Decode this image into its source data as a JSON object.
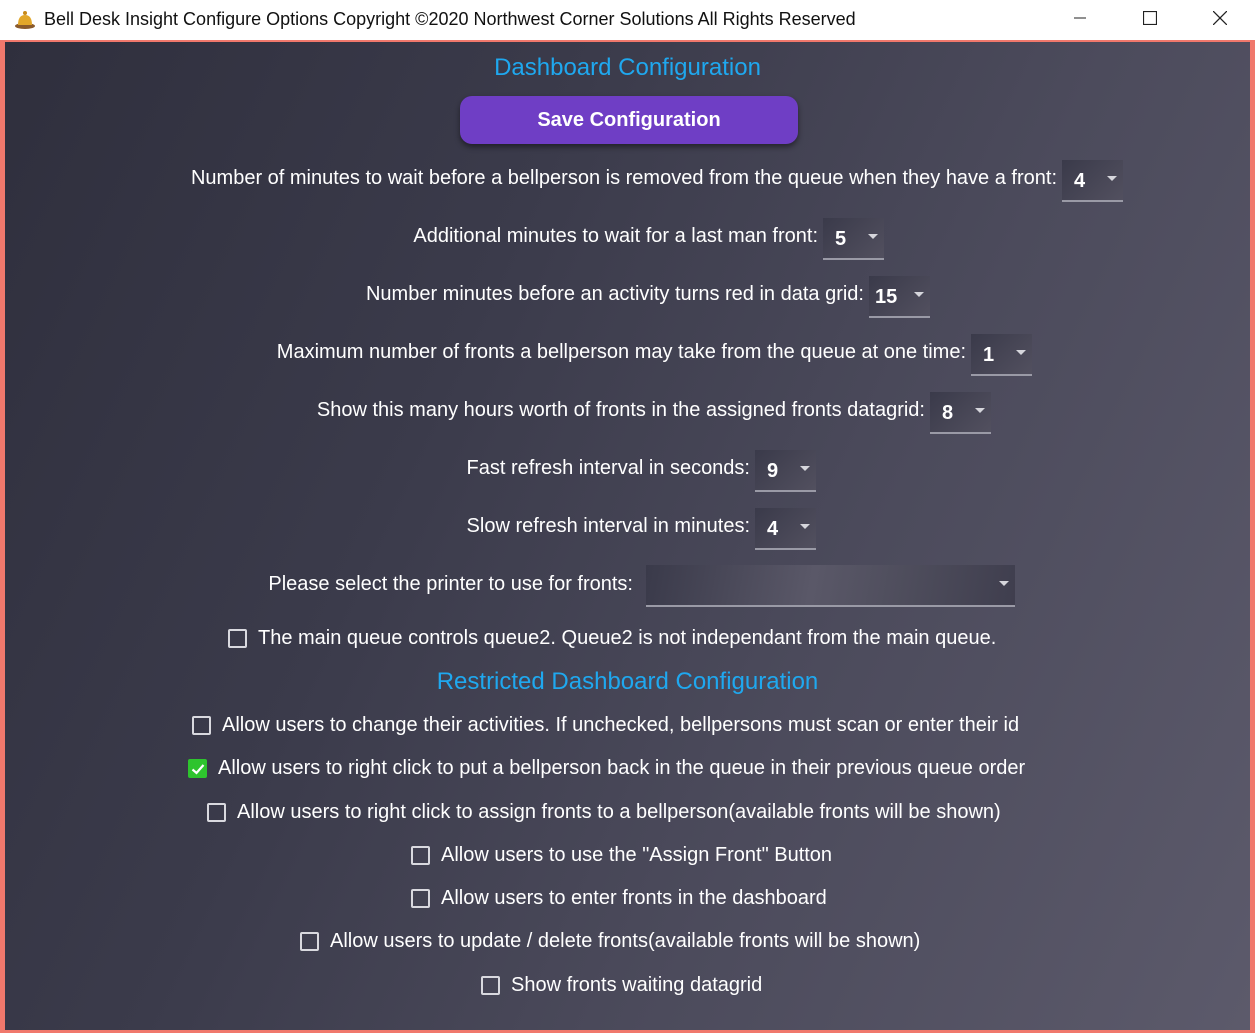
{
  "window": {
    "title": "Bell Desk Insight Configure Options Copyright ©2020 Northwest Corner Solutions All Rights Reserved",
    "app_icon": "bell-icon"
  },
  "dashboard": {
    "heading": "Dashboard Configuration",
    "save_label": "Save Configuration",
    "settings": [
      {
        "label": "Number of minutes to wait before a bellperson is removed from the queue when they have a front:",
        "value": "4"
      },
      {
        "label": "Additional minutes to wait for a last man front:",
        "value": "5"
      },
      {
        "label": "Number minutes before an activity turns red in data grid:",
        "value": "15"
      },
      {
        "label": "Maximum number of fronts a bellperson may take from the queue at one time:",
        "value": "1"
      },
      {
        "label": "Show this many hours worth of fronts in the assigned fronts datagrid:",
        "value": "8"
      },
      {
        "label": "Fast refresh interval in seconds:",
        "value": "9"
      },
      {
        "label": "Slow refresh interval in minutes:",
        "value": "4"
      }
    ],
    "printer_label": "Please select the printer to use for fronts:",
    "printer_value": "",
    "queue_link": {
      "label": "The main queue controls queue2. Queue2 is not independant from the main queue.",
      "checked": false
    }
  },
  "restricted": {
    "heading": "Restricted Dashboard Configuration",
    "options": [
      {
        "label": "Allow users to change their activities. If unchecked, bellpersons must scan or enter their id",
        "checked": false
      },
      {
        "label": "Allow users to right click to put a bellperson back in the queue in their previous queue order",
        "checked": true
      },
      {
        "label": "Allow users to right click to assign fronts to a bellperson(available fronts will be shown)",
        "checked": false
      },
      {
        "label": "Allow users to use the \"Assign Front\" Button",
        "checked": false
      },
      {
        "label": "Allow users to enter fronts in the dashboard",
        "checked": false
      },
      {
        "label": "Allow users to update / delete fronts(available fronts will be shown)",
        "checked": false
      },
      {
        "label": "Show fronts waiting datagrid",
        "checked": false
      }
    ]
  },
  "colors": {
    "accent_heading": "#1fa8ef",
    "save_button": "#6f3ec5",
    "checkbox_checked": "#2ec42e",
    "window_border": "#f0786c"
  }
}
